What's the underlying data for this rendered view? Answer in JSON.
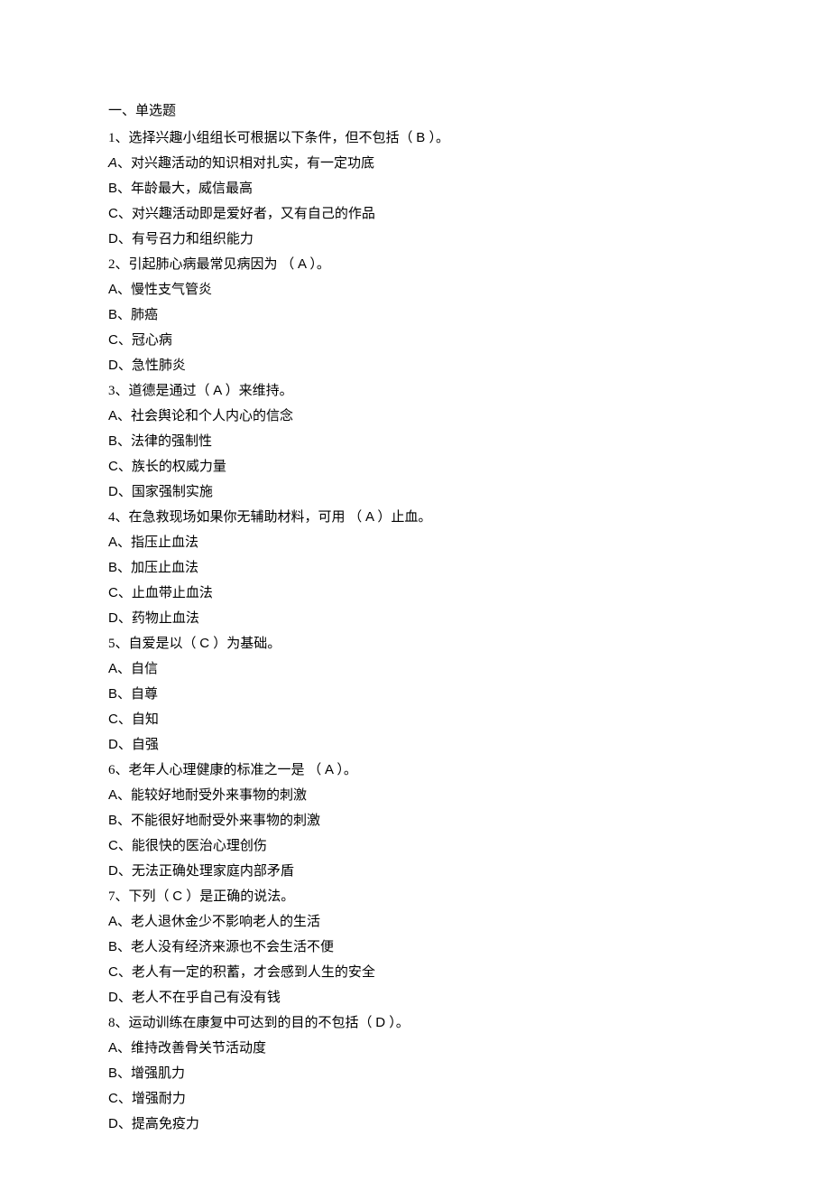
{
  "section_title": "一、单选题",
  "questions": [
    {
      "stem_pre": "1、选择兴趣小组组长可根据以下条件，但不包括（",
      "ans": "B",
      "stem_post": "）。",
      "options": [
        {
          "letter_styled": "A",
          "letter_italic": true,
          "text": "、对兴趣活动的知识相对扎实，有一定功底"
        },
        {
          "letter_styled": "B",
          "letter_italic": false,
          "text": "、年龄最大，威信最高"
        },
        {
          "letter_styled": "C",
          "letter_italic": false,
          "text": "、对兴趣活动即是爱好者，又有自己的作品"
        },
        {
          "letter_styled": "D",
          "letter_italic": false,
          "text": "、有号召力和组织能力"
        }
      ]
    },
    {
      "stem_pre": "2、引起肺心病最常见病因为 （",
      "ans": "A",
      "stem_post": "）。",
      "options": [
        {
          "letter_styled": "A",
          "letter_italic": false,
          "text": "、慢性支气管炎"
        },
        {
          "letter_styled": "B",
          "letter_italic": false,
          "text": "、肺癌"
        },
        {
          "letter_styled": "C",
          "letter_italic": false,
          "text": "、冠心病"
        },
        {
          "letter_styled": "D",
          "letter_italic": false,
          "text": "、急性肺炎"
        }
      ]
    },
    {
      "stem_pre": "3、道德是通过（",
      "ans": "A",
      "stem_post": "）来维持。",
      "options": [
        {
          "letter_styled": "A",
          "letter_italic": false,
          "text": "、社会舆论和个人内心的信念"
        },
        {
          "letter_styled": "B",
          "letter_italic": false,
          "text": "、法律的强制性"
        },
        {
          "letter_styled": "C",
          "letter_italic": false,
          "text": "、族长的权威力量"
        },
        {
          "letter_styled": "D",
          "letter_italic": false,
          "text": "、国家强制实施"
        }
      ]
    },
    {
      "stem_pre": "4、在急救现场如果你无辅助材料，可用 （",
      "ans": "A",
      "stem_post": "）止血。",
      "options": [
        {
          "letter_styled": "A",
          "letter_italic": false,
          "text": "、指压止血法"
        },
        {
          "letter_styled": "B",
          "letter_italic": false,
          "text": "、加压止血法"
        },
        {
          "letter_styled": "C",
          "letter_italic": false,
          "text": "、止血带止血法"
        },
        {
          "letter_styled": "D",
          "letter_italic": false,
          "text": "、药物止血法"
        }
      ]
    },
    {
      "stem_pre": "5、自爱是以（",
      "ans": "C",
      "stem_post": "）为基础。",
      "options": [
        {
          "letter_styled": "A",
          "letter_italic": false,
          "text": "、自信"
        },
        {
          "letter_styled": "B",
          "letter_italic": false,
          "text": "、自尊"
        },
        {
          "letter_styled": "C",
          "letter_italic": false,
          "text": "、自知"
        },
        {
          "letter_styled": "D",
          "letter_italic": false,
          "text": "、自强"
        }
      ]
    },
    {
      "stem_pre": "6、老年人心理健康的标准之一是 （",
      "ans": "A",
      "stem_post": "）。",
      "options": [
        {
          "letter_styled": "A",
          "letter_italic": false,
          "text": "、能较好地耐受外来事物的刺激"
        },
        {
          "letter_styled": "B",
          "letter_italic": false,
          "text": "、不能很好地耐受外来事物的刺激"
        },
        {
          "letter_styled": "C",
          "letter_italic": false,
          "text": "、能很快的医治心理创伤"
        },
        {
          "letter_styled": "D",
          "letter_italic": false,
          "text": "、无法正确处理家庭内部矛盾"
        }
      ]
    },
    {
      "stem_pre": "7、下列（",
      "ans": "C",
      "stem_post": "）是正确的说法。",
      "options": [
        {
          "letter_styled": "A",
          "letter_italic": false,
          "text": "、老人退休金少不影响老人的生活"
        },
        {
          "letter_styled": "B",
          "letter_italic": false,
          "text": "、老人没有经济来源也不会生活不便"
        },
        {
          "letter_styled": "C",
          "letter_italic": false,
          "text": "、老人有一定的积蓄，才会感到人生的安全"
        },
        {
          "letter_styled": "D",
          "letter_italic": false,
          "text": "、老人不在乎自己有没有钱"
        }
      ]
    },
    {
      "stem_pre": "8、运动训练在康复中可达到的目的不包括（",
      "ans": "D",
      "stem_post": "）。",
      "options": [
        {
          "letter_styled": "A",
          "letter_italic": false,
          "text": "、维持改善骨关节活动度"
        },
        {
          "letter_styled": "B",
          "letter_italic": false,
          "text": "、增强肌力"
        },
        {
          "letter_styled": "C",
          "letter_italic": false,
          "text": "、增强耐力"
        },
        {
          "letter_styled": "D",
          "letter_italic": false,
          "text": "、提高免疫力"
        }
      ]
    }
  ]
}
